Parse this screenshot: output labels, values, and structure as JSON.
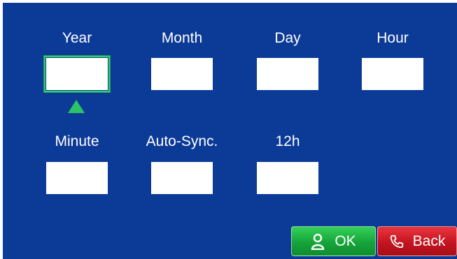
{
  "fields": {
    "year": {
      "label": "Year",
      "value": ""
    },
    "month": {
      "label": "Month",
      "value": ""
    },
    "day": {
      "label": "Day",
      "value": ""
    },
    "hour": {
      "label": "Hour",
      "value": ""
    },
    "minute": {
      "label": "Minute",
      "value": ""
    },
    "auto_sync": {
      "label": "Auto-Sync.",
      "value": ""
    },
    "hour_format": {
      "label": "12h",
      "value": ""
    }
  },
  "selected_field": "year",
  "selection_indicator_icon": "triangle-up-icon",
  "buttons": {
    "ok": {
      "label": "OK",
      "icon": "user-icon",
      "color": "#1ba83e"
    },
    "back": {
      "label": "Back",
      "icon": "phone-icon",
      "color": "#c8161f"
    }
  },
  "colors": {
    "background": "#0c3a97",
    "selection": "#2fd06c",
    "field_box": "#ffffff"
  }
}
